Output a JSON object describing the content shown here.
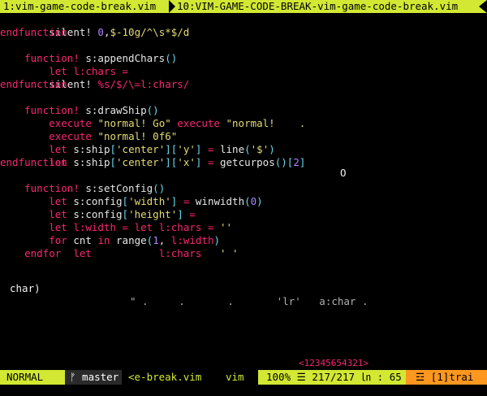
{
  "tabs": [
    {
      "label": "1:vim-game-code-break.vim"
    },
    {
      "label": "10:VIM-GAME-CODE-BREAK-vim-game-code-break.vim"
    }
  ],
  "code_lines": [
    "    silent! 0,$-10g/^\\s*$/d",
    "endfunction",
    "function! s:appendChars()",
    "    let l:chars =",
    "    silent! %s/$/\\=l:chars/",
    "endfunction",
    "function! s:drawShip()",
    "    execute \"normal! Go\" execute \"normal!    .",
    "    execute \"normal! 0f6\"",
    "    let s:ship['center']['y'] = line('$')",
    "    let s:ship['center']['x'] = getcurpos()[2]",
    "endfunction",
    "function! s:setConfig()",
    "    let s:config['width'] = winwidth(0)",
    "    let s:config['height'] =",
    "    let l:width = let l:chars = ''",
    "    for cnt in range(1, l:width)",
    "        let           l:chars   ' '",
    "    endfor"
  ],
  "floating": {
    "zero": "O",
    "char": "char)",
    "ghost": "\" .     .       .       'lr'   a:char ."
  },
  "indicator": "<12345654321>",
  "statusline": {
    "mode": "NORMAL",
    "git_icon": "ᚠ",
    "branch": "master",
    "filename": "<e-break.vim",
    "filetype": "vim",
    "percent": "100%",
    "lines_icon": "☰",
    "line_pos": "217/217",
    "col_icon": "㏑",
    "col": ": 65",
    "warning_icon": "☲",
    "warning": "[1]trai"
  },
  "colors": {
    "accent": "#d2e832",
    "keyword": "#f92672",
    "string": "#e6db74",
    "number": "#ae81ff",
    "paren": "#66d9ef",
    "warning": "#fd971f"
  }
}
